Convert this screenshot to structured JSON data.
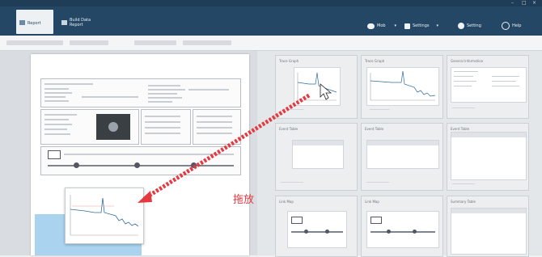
{
  "window": {
    "title": "",
    "controls": [
      "–",
      "□",
      "×"
    ]
  },
  "ribbon": {
    "tabs": [
      {
        "label": "Report",
        "active": true
      },
      {
        "label": "Build Data Report",
        "active": false
      }
    ],
    "buttons": [
      {
        "label": "Mob",
        "icon": "cloud-icon"
      },
      {
        "label": "Settings",
        "icon": "square-icon"
      },
      {
        "label": "Setting",
        "icon": "gear-icon"
      },
      {
        "label": "Help",
        "icon": "help-icon"
      }
    ]
  },
  "templates": [
    {
      "title": "Trace Graph"
    },
    {
      "title": "Trace Graph"
    },
    {
      "title": "General Information"
    },
    {
      "title": "Event Table"
    },
    {
      "title": "Event Table"
    },
    {
      "title": "Event Table"
    },
    {
      "title": "Link Map"
    },
    {
      "title": "Link Map"
    },
    {
      "title": "Summary Table"
    }
  ],
  "drop_label": "拖放",
  "colors": {
    "ribbon": "#254766",
    "arrow": "#e53940",
    "highlight": "#a9d3ee"
  }
}
